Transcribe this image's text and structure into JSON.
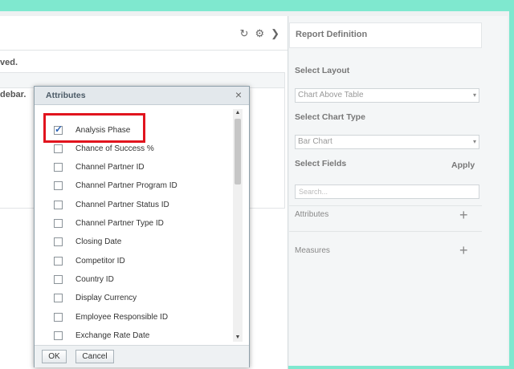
{
  "main": {
    "saved_text": "ved.",
    "sidebar_text": "debar.",
    "icons": [
      "refresh-icon",
      "gear-icon",
      "chevron-right-icon"
    ]
  },
  "report_definition": {
    "title": "Report Definition",
    "select_layout_label": "Select Layout",
    "layout_value": "Chart Above Table",
    "select_chart_type_label": "Select Chart Type",
    "chart_type_value": "Bar Chart",
    "select_fields_label": "Select Fields",
    "apply_label": "Apply",
    "search_placeholder": "Search...",
    "attributes_label": "Attributes",
    "measures_label": "Measures"
  },
  "dialog": {
    "title": "Attributes",
    "close": "×",
    "items": [
      {
        "label": "Analysis Phase",
        "checked": true
      },
      {
        "label": "Chance of Success %",
        "checked": false
      },
      {
        "label": "Channel Partner ID",
        "checked": false
      },
      {
        "label": "Channel Partner Program ID",
        "checked": false
      },
      {
        "label": "Channel Partner Status ID",
        "checked": false
      },
      {
        "label": "Channel Partner Type ID",
        "checked": false
      },
      {
        "label": "Closing Date",
        "checked": false
      },
      {
        "label": "Competitor ID",
        "checked": false
      },
      {
        "label": "Country ID",
        "checked": false
      },
      {
        "label": "Display Currency",
        "checked": false
      },
      {
        "label": "Employee Responsible ID",
        "checked": false
      },
      {
        "label": "Exchange Rate Date",
        "checked": false
      }
    ],
    "ok_label": "OK",
    "cancel_label": "Cancel"
  },
  "colors": {
    "top_bar": "#7fe8cf",
    "highlight": "#e1141e",
    "check": "#2b63b7"
  }
}
